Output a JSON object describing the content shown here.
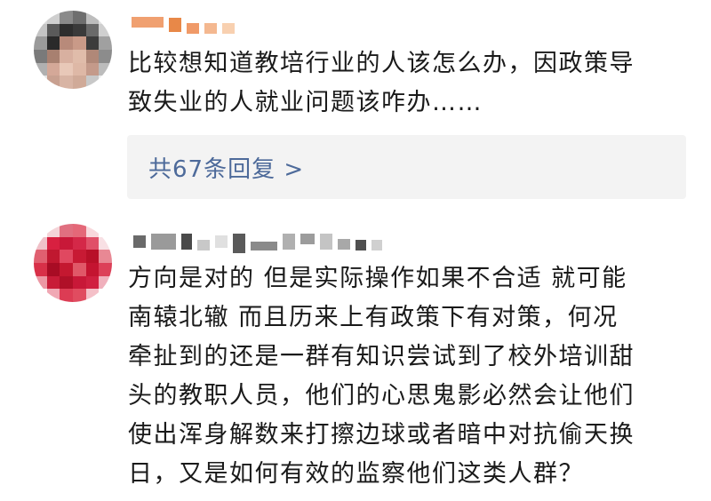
{
  "comments": [
    {
      "text_lines": [
        "比较想知道教培行业的人该怎么办，因政策导",
        "致失业的人就业问题该咋办……"
      ],
      "replies_link": "共67条回复 >"
    },
    {
      "text_lines": [
        "方向是对的 但是实际操作如果不合适 就可能",
        "南辕北辙 而且历来上有政策下有对策，何况",
        "牵扯到的还是一群有知识尝试到了校外培训甜",
        "头的教职人员，他们的心思鬼影必然会让他们",
        "使出浑身解数来打擦边球或者暗中对抗偷天换",
        "日，又是如何有效的监察他们这类人群？"
      ]
    }
  ],
  "colors": {
    "link": "#4d6a9a",
    "reply_box_bg": "#f3f3f3",
    "text": "#1a1a1a"
  },
  "icons": {
    "avatar_1": "pixelated-avatar",
    "avatar_2": "pixelated-avatar"
  }
}
